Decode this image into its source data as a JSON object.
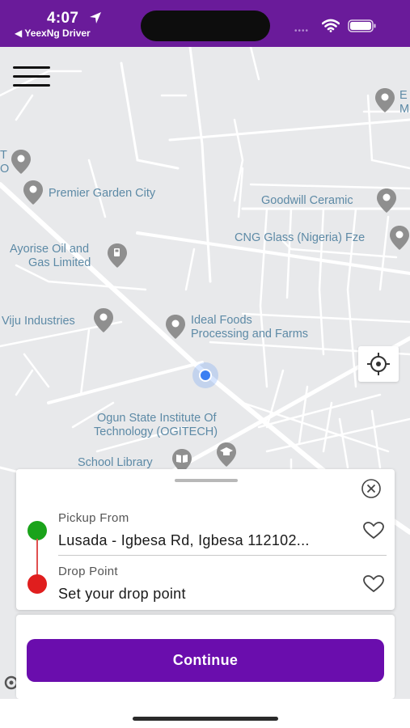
{
  "status_bar": {
    "time": "4:07",
    "back_app": "◀ YeexNg Driver",
    "signal": "••••"
  },
  "map": {
    "places": [
      {
        "id": "premier-garden",
        "label": "Premier Garden City"
      },
      {
        "id": "goodwill",
        "label": "Goodwill Ceramic"
      },
      {
        "id": "cng-glass",
        "label": "CNG Glass (Nigeria) Fze"
      },
      {
        "id": "ayorise-1",
        "label": "Ayorise Oil and"
      },
      {
        "id": "ayorise-2",
        "label": "Gas Limited"
      },
      {
        "id": "viju",
        "label": "Viju Industries"
      },
      {
        "id": "ideal-1",
        "label": "Ideal Foods"
      },
      {
        "id": "ideal-2",
        "label": "Processing and Farms"
      },
      {
        "id": "ogun-1",
        "label": "Ogun State Institute Of"
      },
      {
        "id": "ogun-2",
        "label": "Technology (OGITECH)"
      },
      {
        "id": "school-library",
        "label": "School Library"
      },
      {
        "id": "edge-top-right-1",
        "label": "E"
      },
      {
        "id": "edge-top-right-2",
        "label": "M"
      },
      {
        "id": "edge-left-1",
        "label": "T"
      },
      {
        "id": "edge-left-2",
        "label": "O"
      }
    ],
    "colors": {
      "road": "#ffffff",
      "land": "#e8e9eb",
      "label": "#5d8aa6",
      "pin": "#8f8f8f"
    }
  },
  "route": {
    "pickup_label": "Pickup From",
    "pickup_value": "Lusada - Igbesa Rd, Igbesa 112102...",
    "drop_label": "Drop Point",
    "drop_value": "Set your drop point",
    "colors": {
      "pickup": "#1aa31a",
      "drop": "#e01e1e"
    }
  },
  "actions": {
    "continue_label": "Continue",
    "accent": "#6a0dad"
  },
  "icons": {
    "menu": "hamburger-menu-icon",
    "recenter": "crosshair-icon",
    "close": "close-circle-icon",
    "favorite": "heart-outline-icon"
  }
}
